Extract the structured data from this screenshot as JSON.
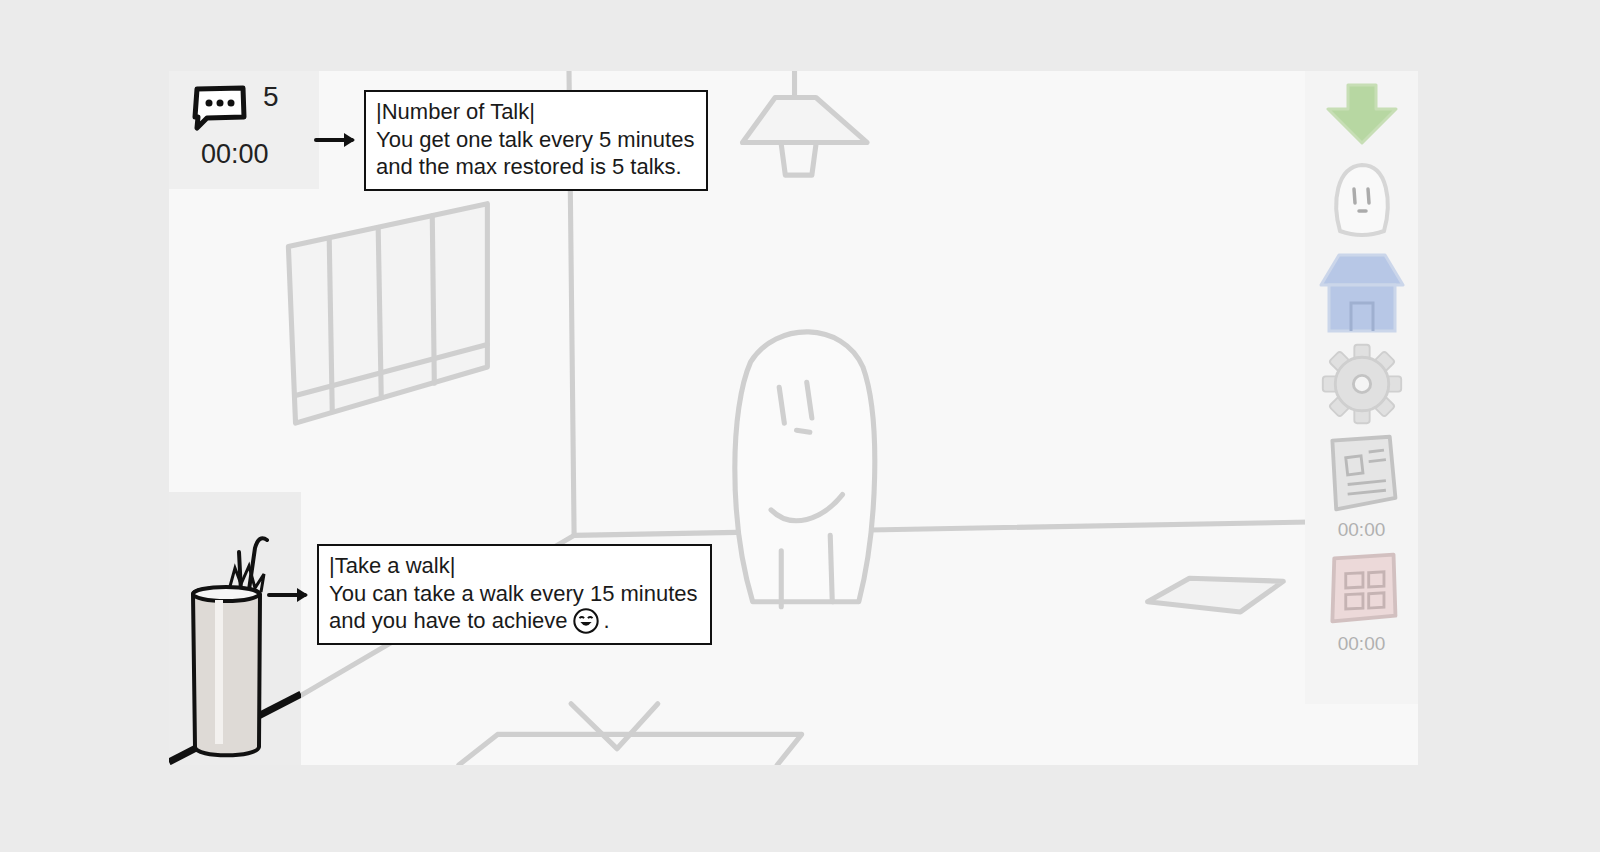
{
  "talk": {
    "count": "5",
    "timer": "00:00"
  },
  "tips": [
    {
      "kind": "plain",
      "title": "|Number of Talk|",
      "lines": [
        "You get one talk every 5 minutes",
        "and the max restored is 5 talks."
      ]
    },
    {
      "kind": "mood",
      "title": "|Take a walk|",
      "lines": [
        "You can take a walk every 15 minutes",
        "and you have to achieve"
      ],
      "end": "."
    }
  ],
  "sidebar": [
    {
      "kind": "download",
      "disabled": false
    },
    {
      "kind": "ghost",
      "disabled": false
    },
    {
      "kind": "house",
      "disabled": false
    },
    {
      "kind": "settings",
      "disabled": false
    },
    {
      "kind": "news",
      "disabled": true,
      "timer": "00:00"
    },
    {
      "kind": "calendar",
      "disabled": true,
      "timer": "00:00"
    }
  ]
}
